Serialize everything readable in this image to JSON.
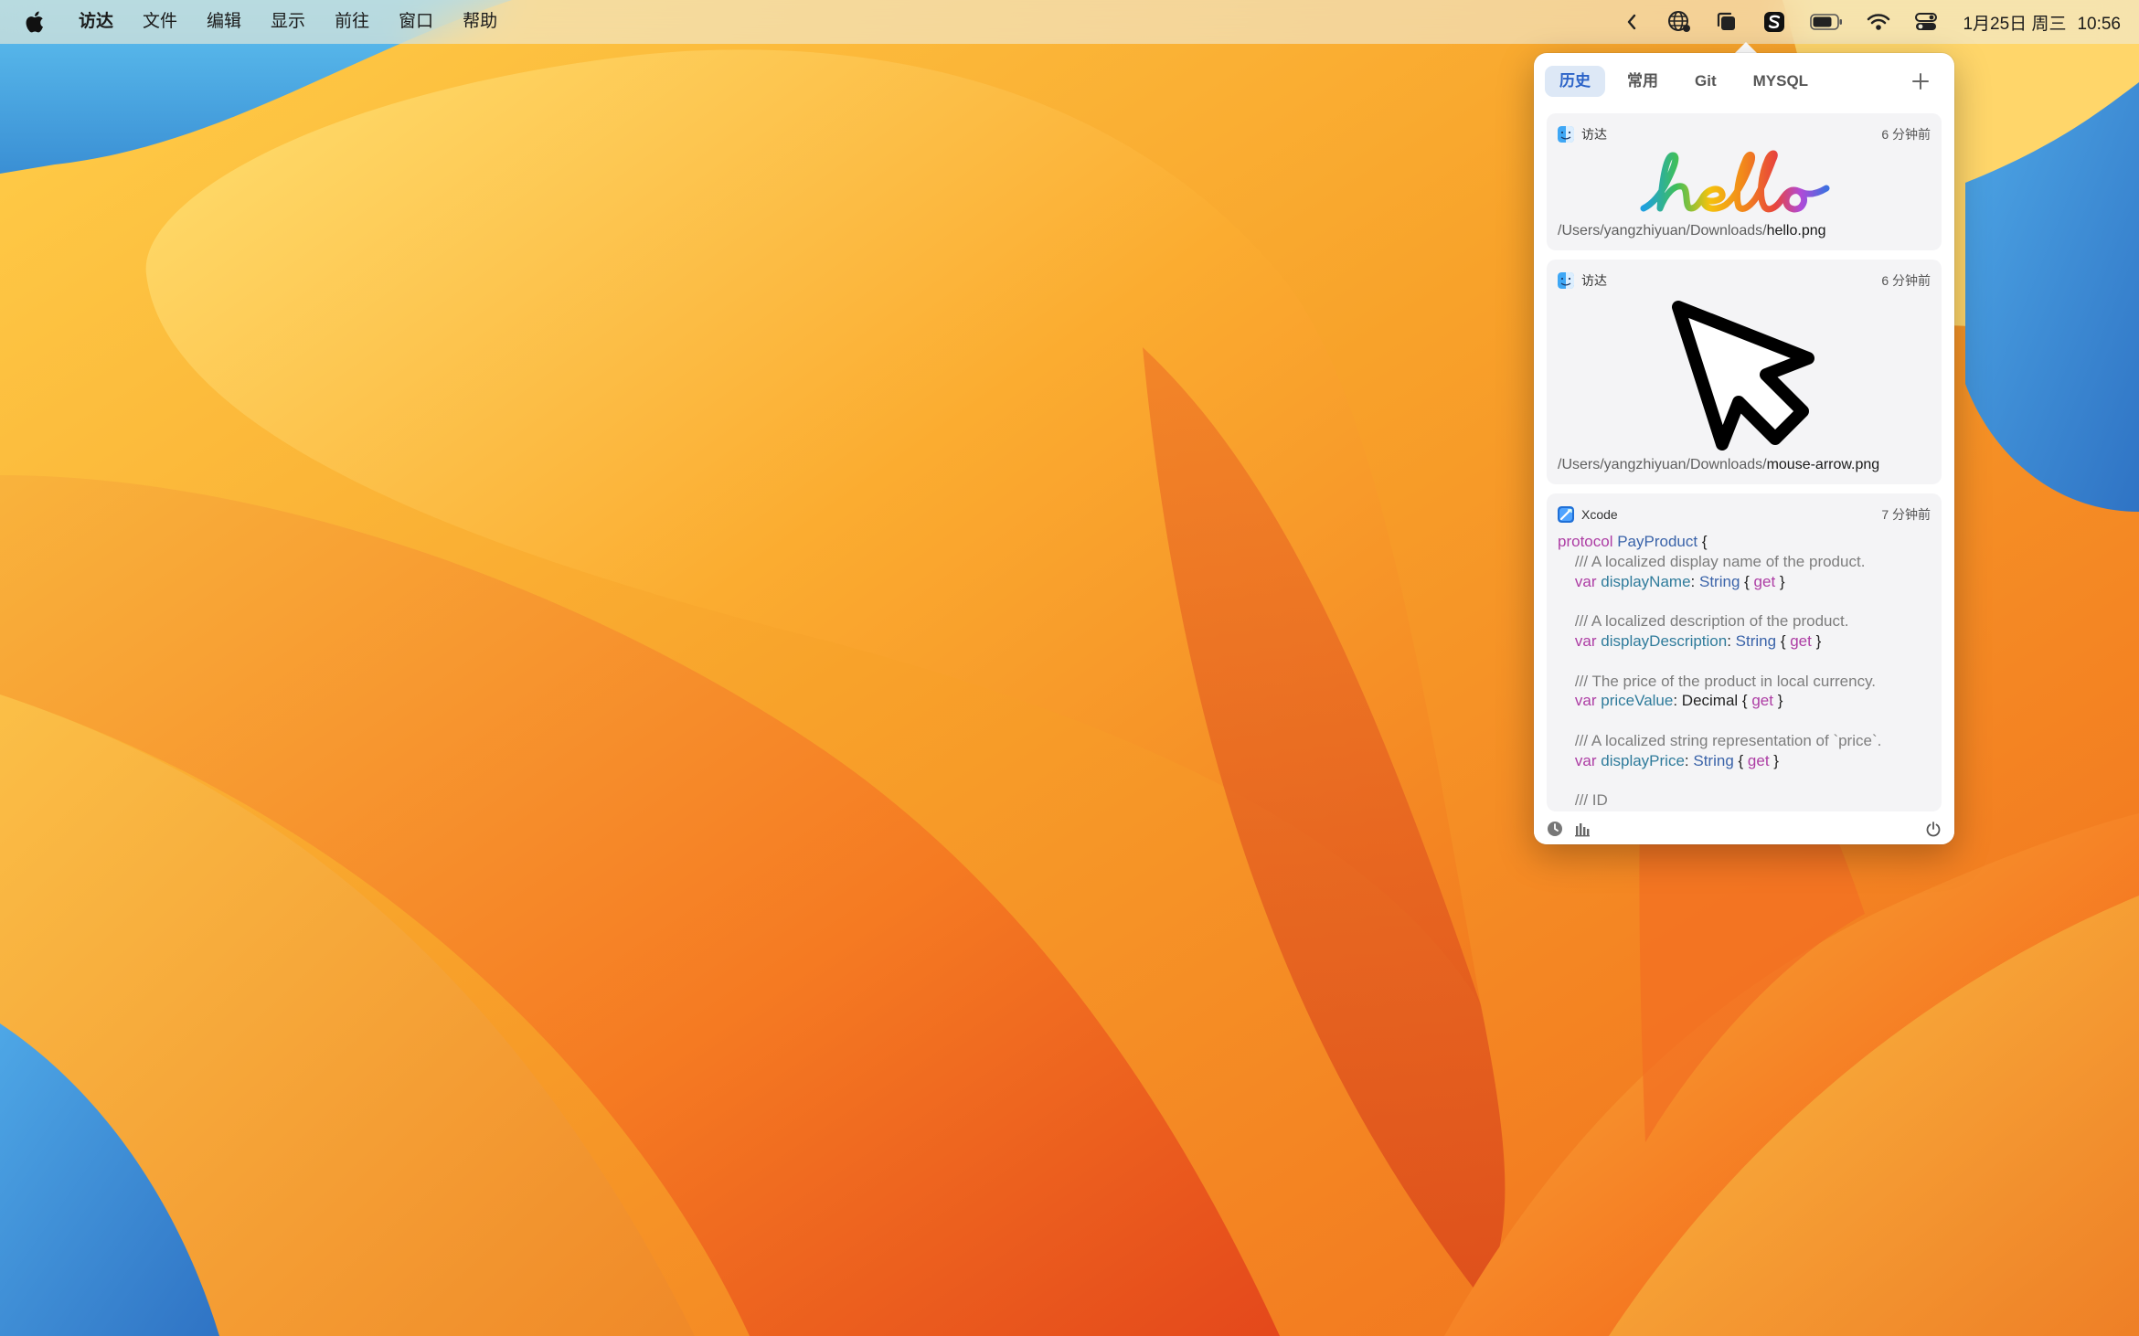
{
  "menubar": {
    "app_name": "访达",
    "menus": [
      "文件",
      "编辑",
      "显示",
      "前往",
      "窗口",
      "帮助"
    ],
    "clock": {
      "date": "1月25日 周三",
      "time": "10:56"
    },
    "status_icons": [
      "chevron-left-icon",
      "globe-icon",
      "clipboard-icon",
      "s-app-icon",
      "battery-icon",
      "wifi-icon",
      "control-center-icon"
    ]
  },
  "panel": {
    "tabs": [
      "历史",
      "常用",
      "Git",
      "MYSQL"
    ],
    "active_tab": "历史",
    "add_icon": "plus-icon",
    "items": [
      {
        "app": "访达",
        "time": "6 分钟前",
        "path_prefix": "/Users/yangzhiyuan/Downloads/",
        "filename": "hello.png",
        "preview_text": "hello"
      },
      {
        "app": "访达",
        "time": "6 分钟前",
        "path_prefix": "/Users/yangzhiyuan/Downloads/",
        "filename": "mouse-arrow.png"
      },
      {
        "app": "Xcode",
        "time": "7 分钟前",
        "code": [
          {
            "kw": "protocol",
            "type": "PayProduct",
            "rest": " {"
          },
          {
            "comment": "    /// A localized display name of the product."
          },
          {
            "indent": "    ",
            "kw": "var",
            "prop": "displayName",
            "colon": ": ",
            "type": "String",
            "open": " { ",
            "get": "get",
            "close": " }"
          },
          {
            "comment": ""
          },
          {
            "comment": "    /// A localized description of the product."
          },
          {
            "indent": "    ",
            "kw": "var",
            "prop": "displayDescription",
            "colon": ": ",
            "type": "String",
            "open": " { ",
            "get": "get",
            "close": " }"
          },
          {
            "comment": ""
          },
          {
            "comment": "    /// The price of the product in local currency."
          },
          {
            "indent": "    ",
            "kw": "var",
            "prop": "priceValue",
            "colon": ": ",
            "plain": "Decimal",
            "open": " { ",
            "get": "get",
            "close": " }"
          },
          {
            "comment": ""
          },
          {
            "comment": "    /// A localized string representation of `price`."
          },
          {
            "indent": "    ",
            "kw": "var",
            "prop": "displayPrice",
            "colon": ": ",
            "type": "String",
            "open": " { ",
            "get": "get",
            "close": " }"
          },
          {
            "comment": ""
          },
          {
            "comment": "    /// ID"
          }
        ]
      }
    ],
    "footer_icons": [
      "history-clock-icon",
      "stats-bars-icon",
      "power-icon"
    ]
  }
}
